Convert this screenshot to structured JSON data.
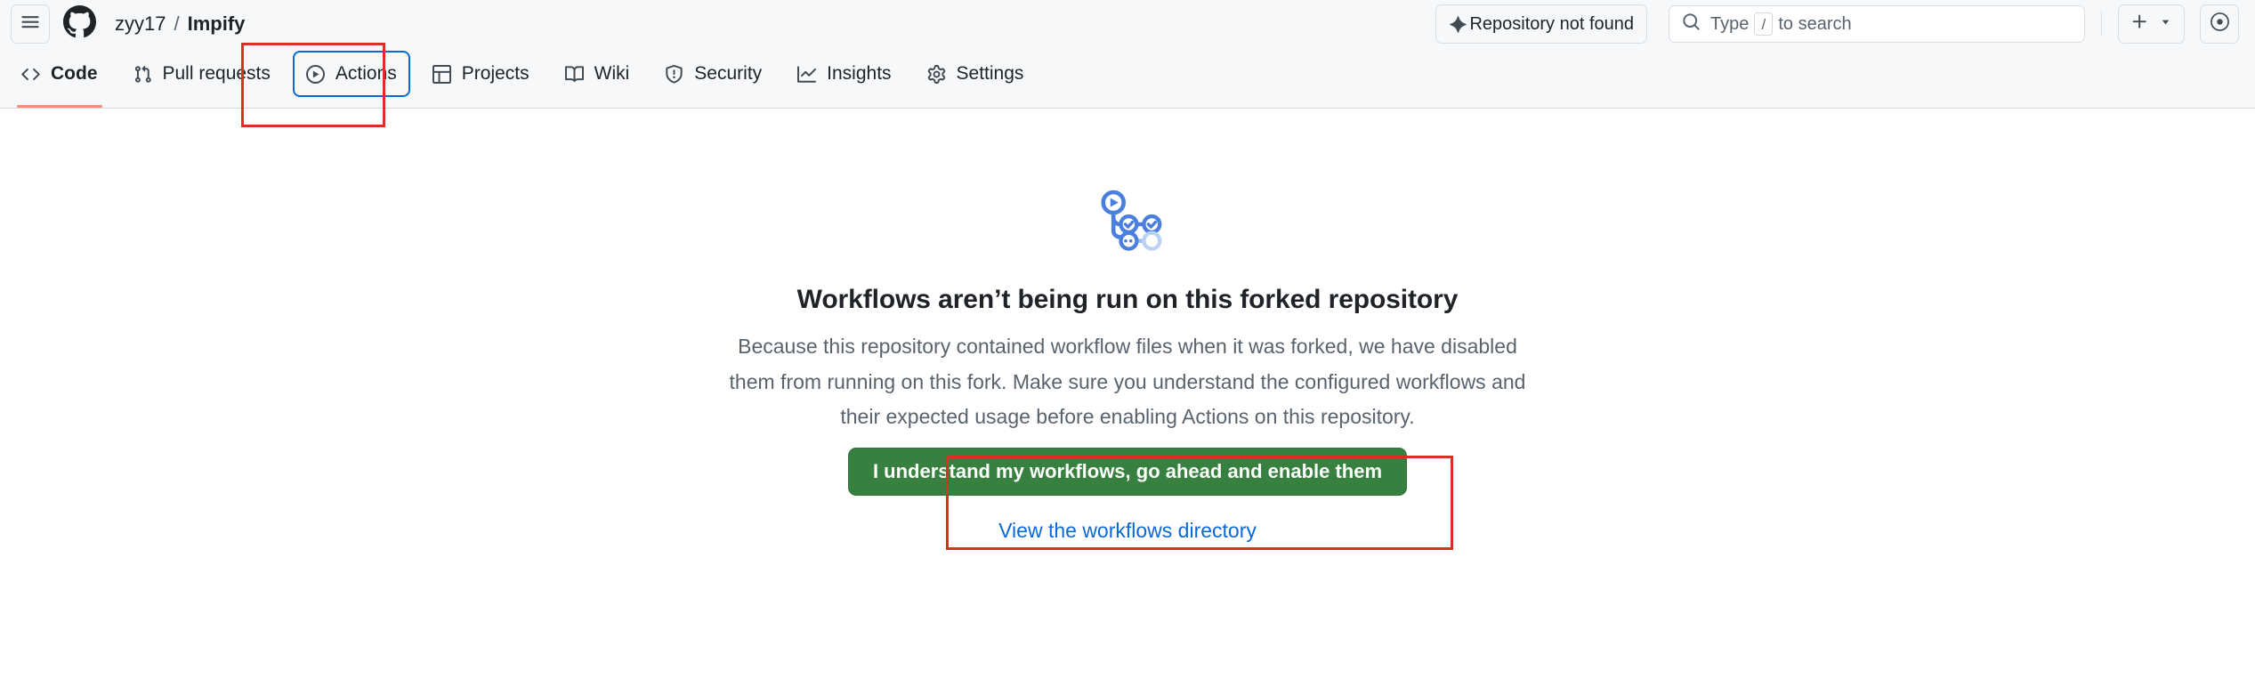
{
  "header": {
    "menu_icon": "hamburger-menu-icon",
    "logo_icon": "github-logo-icon",
    "breadcrumb": {
      "owner": "zyy17",
      "separator": "/",
      "repo": "Impify"
    },
    "repo_state_badge": {
      "icon": "sparkle-icon",
      "label": "Repository not found"
    },
    "search": {
      "icon": "search-icon",
      "prefix": "Type",
      "key": "/",
      "suffix": "to search",
      "value": "",
      "placeholder": "Type / to search"
    },
    "create": {
      "icon": "plus-icon",
      "chevron": "chevron-down-icon"
    },
    "avatar": {
      "icon": "user-avatar-icon"
    }
  },
  "repo_nav": {
    "tabs": [
      {
        "label": "Code",
        "icon": "code-icon",
        "selected": true,
        "focused": false
      },
      {
        "label": "Pull requests",
        "icon": "git-pull-request-icon",
        "selected": false,
        "focused": false
      },
      {
        "label": "Actions",
        "icon": "play-circle-icon",
        "selected": false,
        "focused": true
      },
      {
        "label": "Projects",
        "icon": "table-icon",
        "selected": false,
        "focused": false
      },
      {
        "label": "Wiki",
        "icon": "book-icon",
        "selected": false,
        "focused": false
      },
      {
        "label": "Security",
        "icon": "shield-icon",
        "selected": false,
        "focused": false
      },
      {
        "label": "Insights",
        "icon": "graph-icon",
        "selected": false,
        "focused": false
      },
      {
        "label": "Settings",
        "icon": "gear-icon",
        "selected": false,
        "focused": false
      }
    ]
  },
  "main": {
    "illustration_icon": "actions-workflow-illustration",
    "heading": "Workflows aren’t being run on this forked repository",
    "description": "Because this repository contained workflow files when it was forked, we have disabled them from running on this fork. Make sure you understand the configured workflows and their expected usage before enabling Actions on this repository.",
    "enable_button_label": "I understand my workflows, go ahead and enable them",
    "view_directory_link": "View the workflows directory"
  },
  "colors": {
    "accent_blue": "#0969da",
    "success_green": "#37803f",
    "active_tab_underline": "#fd8c73",
    "header_background": "#f6f8fa",
    "annotation_red": "#d93025",
    "muted_text": "#59636e"
  }
}
